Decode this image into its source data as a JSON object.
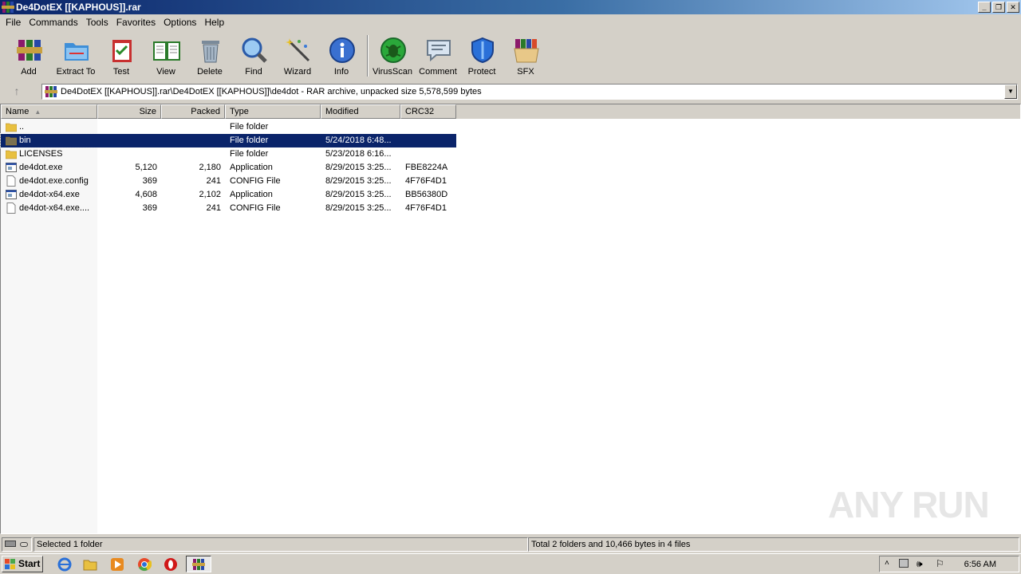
{
  "window": {
    "title": "De4DotEX [[KAPHOUS]].rar"
  },
  "menu": [
    "File",
    "Commands",
    "Tools",
    "Favorites",
    "Options",
    "Help"
  ],
  "toolbar": [
    {
      "label": "Add",
      "icon": "winrar-books-icon"
    },
    {
      "label": "Extract To",
      "icon": "folder-extract-icon"
    },
    {
      "label": "Test",
      "icon": "clipboard-check-icon"
    },
    {
      "label": "View",
      "icon": "open-book-icon"
    },
    {
      "label": "Delete",
      "icon": "trash-can-icon"
    },
    {
      "label": "Find",
      "icon": "magnifier-icon"
    },
    {
      "label": "Wizard",
      "icon": "magic-wand-icon"
    },
    {
      "label": "Info",
      "icon": "info-icon"
    },
    {
      "label": "VirusScan",
      "icon": "bug-scan-icon"
    },
    {
      "label": "Comment",
      "icon": "comment-icon"
    },
    {
      "label": "Protect",
      "icon": "shield-icon"
    },
    {
      "label": "SFX",
      "icon": "sfx-box-icon"
    }
  ],
  "address": {
    "text": "De4DotEX [[KAPHOUS]].rar\\De4DotEX [[KAPHOUS]]\\de4dot - RAR archive, unpacked size 5,578,599 bytes"
  },
  "columns": [
    "Name",
    "Size",
    "Packed",
    "Type",
    "Modified",
    "CRC32"
  ],
  "files": [
    {
      "name": "..",
      "size": "",
      "packed": "",
      "type": "File folder",
      "modified": "",
      "crc": "",
      "kind": "folder"
    },
    {
      "name": "bin",
      "size": "",
      "packed": "",
      "type": "File folder",
      "modified": "5/24/2018 6:48...",
      "crc": "",
      "kind": "folder"
    },
    {
      "name": "LICENSES",
      "size": "",
      "packed": "",
      "type": "File folder",
      "modified": "5/23/2018 6:16...",
      "crc": "",
      "kind": "folder"
    },
    {
      "name": "de4dot.exe",
      "size": "5,120",
      "packed": "2,180",
      "type": "Application",
      "modified": "8/29/2015 3:25...",
      "crc": "FBE8224A",
      "kind": "exe"
    },
    {
      "name": "de4dot.exe.config",
      "size": "369",
      "packed": "241",
      "type": "CONFIG File",
      "modified": "8/29/2015 3:25...",
      "crc": "4F76F4D1",
      "kind": "file"
    },
    {
      "name": "de4dot-x64.exe",
      "size": "4,608",
      "packed": "2,102",
      "type": "Application",
      "modified": "8/29/2015 3:25...",
      "crc": "BB56380D",
      "kind": "exe"
    },
    {
      "name": "de4dot-x64.exe....",
      "size": "369",
      "packed": "241",
      "type": "CONFIG File",
      "modified": "8/29/2015 3:25...",
      "crc": "4F76F4D1",
      "kind": "file"
    }
  ],
  "selected_index": 1,
  "status": {
    "left": "Selected 1 folder",
    "right": "Total 2 folders and 10,466 bytes in 4 files"
  },
  "taskbar": {
    "start": "Start",
    "clock": "6:56 AM"
  },
  "watermark": "ANY RUN",
  "colors": {
    "selection": "#0a246a",
    "title_start": "#0a246a",
    "title_end": "#a6caf0"
  }
}
